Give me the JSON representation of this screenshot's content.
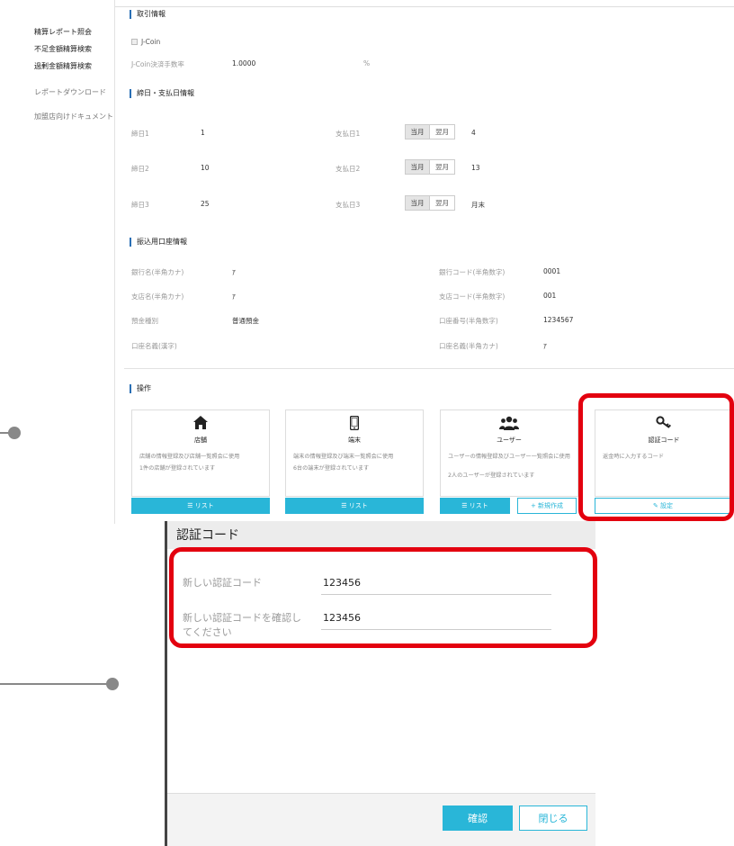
{
  "sidebar": {
    "items": [
      {
        "label": "精算レポート照会"
      },
      {
        "label": "不足金額精算検索"
      },
      {
        "label": "過剰金額精算検索"
      },
      {
        "label": "レポートダウンロード"
      },
      {
        "label": "加盟店向けドキュメント"
      }
    ]
  },
  "trade_info": {
    "title": "取引情報",
    "jcoin_label": "J-Coin",
    "rate_label": "J-Coin決済手数率",
    "rate_value": "1.0000",
    "rate_unit": "%"
  },
  "closing": {
    "title": "締日・支払日情報",
    "rows": [
      {
        "close_label": "締日1",
        "close_value": "1",
        "pay_label": "支払日1",
        "seg_a": "当月",
        "seg_b": "翌月",
        "pay_value": "4"
      },
      {
        "close_label": "締日2",
        "close_value": "10",
        "pay_label": "支払日2",
        "seg_a": "当月",
        "seg_b": "翌月",
        "pay_value": "13"
      },
      {
        "close_label": "締日3",
        "close_value": "25",
        "pay_label": "支払日3",
        "seg_a": "当月",
        "seg_b": "翌月",
        "pay_value": "月末"
      }
    ]
  },
  "bank": {
    "title": "振込用口座情報",
    "left": [
      {
        "label": "銀行名(半角カナ)",
        "value": "ｱ"
      },
      {
        "label": "支店名(半角カナ)",
        "value": "ｱ"
      },
      {
        "label": "預金種別",
        "value": "普通預金"
      },
      {
        "label": "口座名義(漢字)",
        "value": ""
      }
    ],
    "right": [
      {
        "label": "銀行コード(半角数字)",
        "value": "0001"
      },
      {
        "label": "支店コード(半角数字)",
        "value": "001"
      },
      {
        "label": "口座番号(半角数字)",
        "value": "1234567"
      },
      {
        "label": "口座名義(半角カナ)",
        "value": "ｱ"
      }
    ]
  },
  "operations": {
    "title": "操作",
    "cards": [
      {
        "icon": "home-icon",
        "title": "店舗",
        "desc1": "店舗の情報登録及び店舗一覧照会に使用",
        "desc2": "1件の店舗が登録されています",
        "btn": "☰ リスト"
      },
      {
        "icon": "phone-icon",
        "title": "端末",
        "desc1": "端末の情報登録及び端末一覧照会に使用",
        "desc2": "6台の端末が登録されています",
        "btn": "☰ リスト"
      },
      {
        "icon": "users-icon",
        "title": "ユーザー",
        "desc1": "ユーザーの情報登録及びユーザー一覧照会に使用",
        "desc2": "2人のユーザーが登録されています",
        "btn": "☰ リスト",
        "btn2": "+ 新規作成"
      },
      {
        "icon": "key-icon",
        "title": "認証コード",
        "desc1": "返金時に入力するコード",
        "desc2": "",
        "btn": "✎ 設定"
      }
    ]
  },
  "dialog": {
    "title": "認証コード",
    "new_code_label": "新しい認証コード",
    "new_code_value": "123456",
    "confirm_label_line1": "新しい認証コードを確認し",
    "confirm_label_line2": "てください",
    "confirm_value": "123456",
    "confirm_button": "確認",
    "close_button": "閉じる"
  },
  "colors": {
    "accent": "#29b6d8",
    "highlight": "#e3000f",
    "section_bar": "#2a6fb5"
  }
}
